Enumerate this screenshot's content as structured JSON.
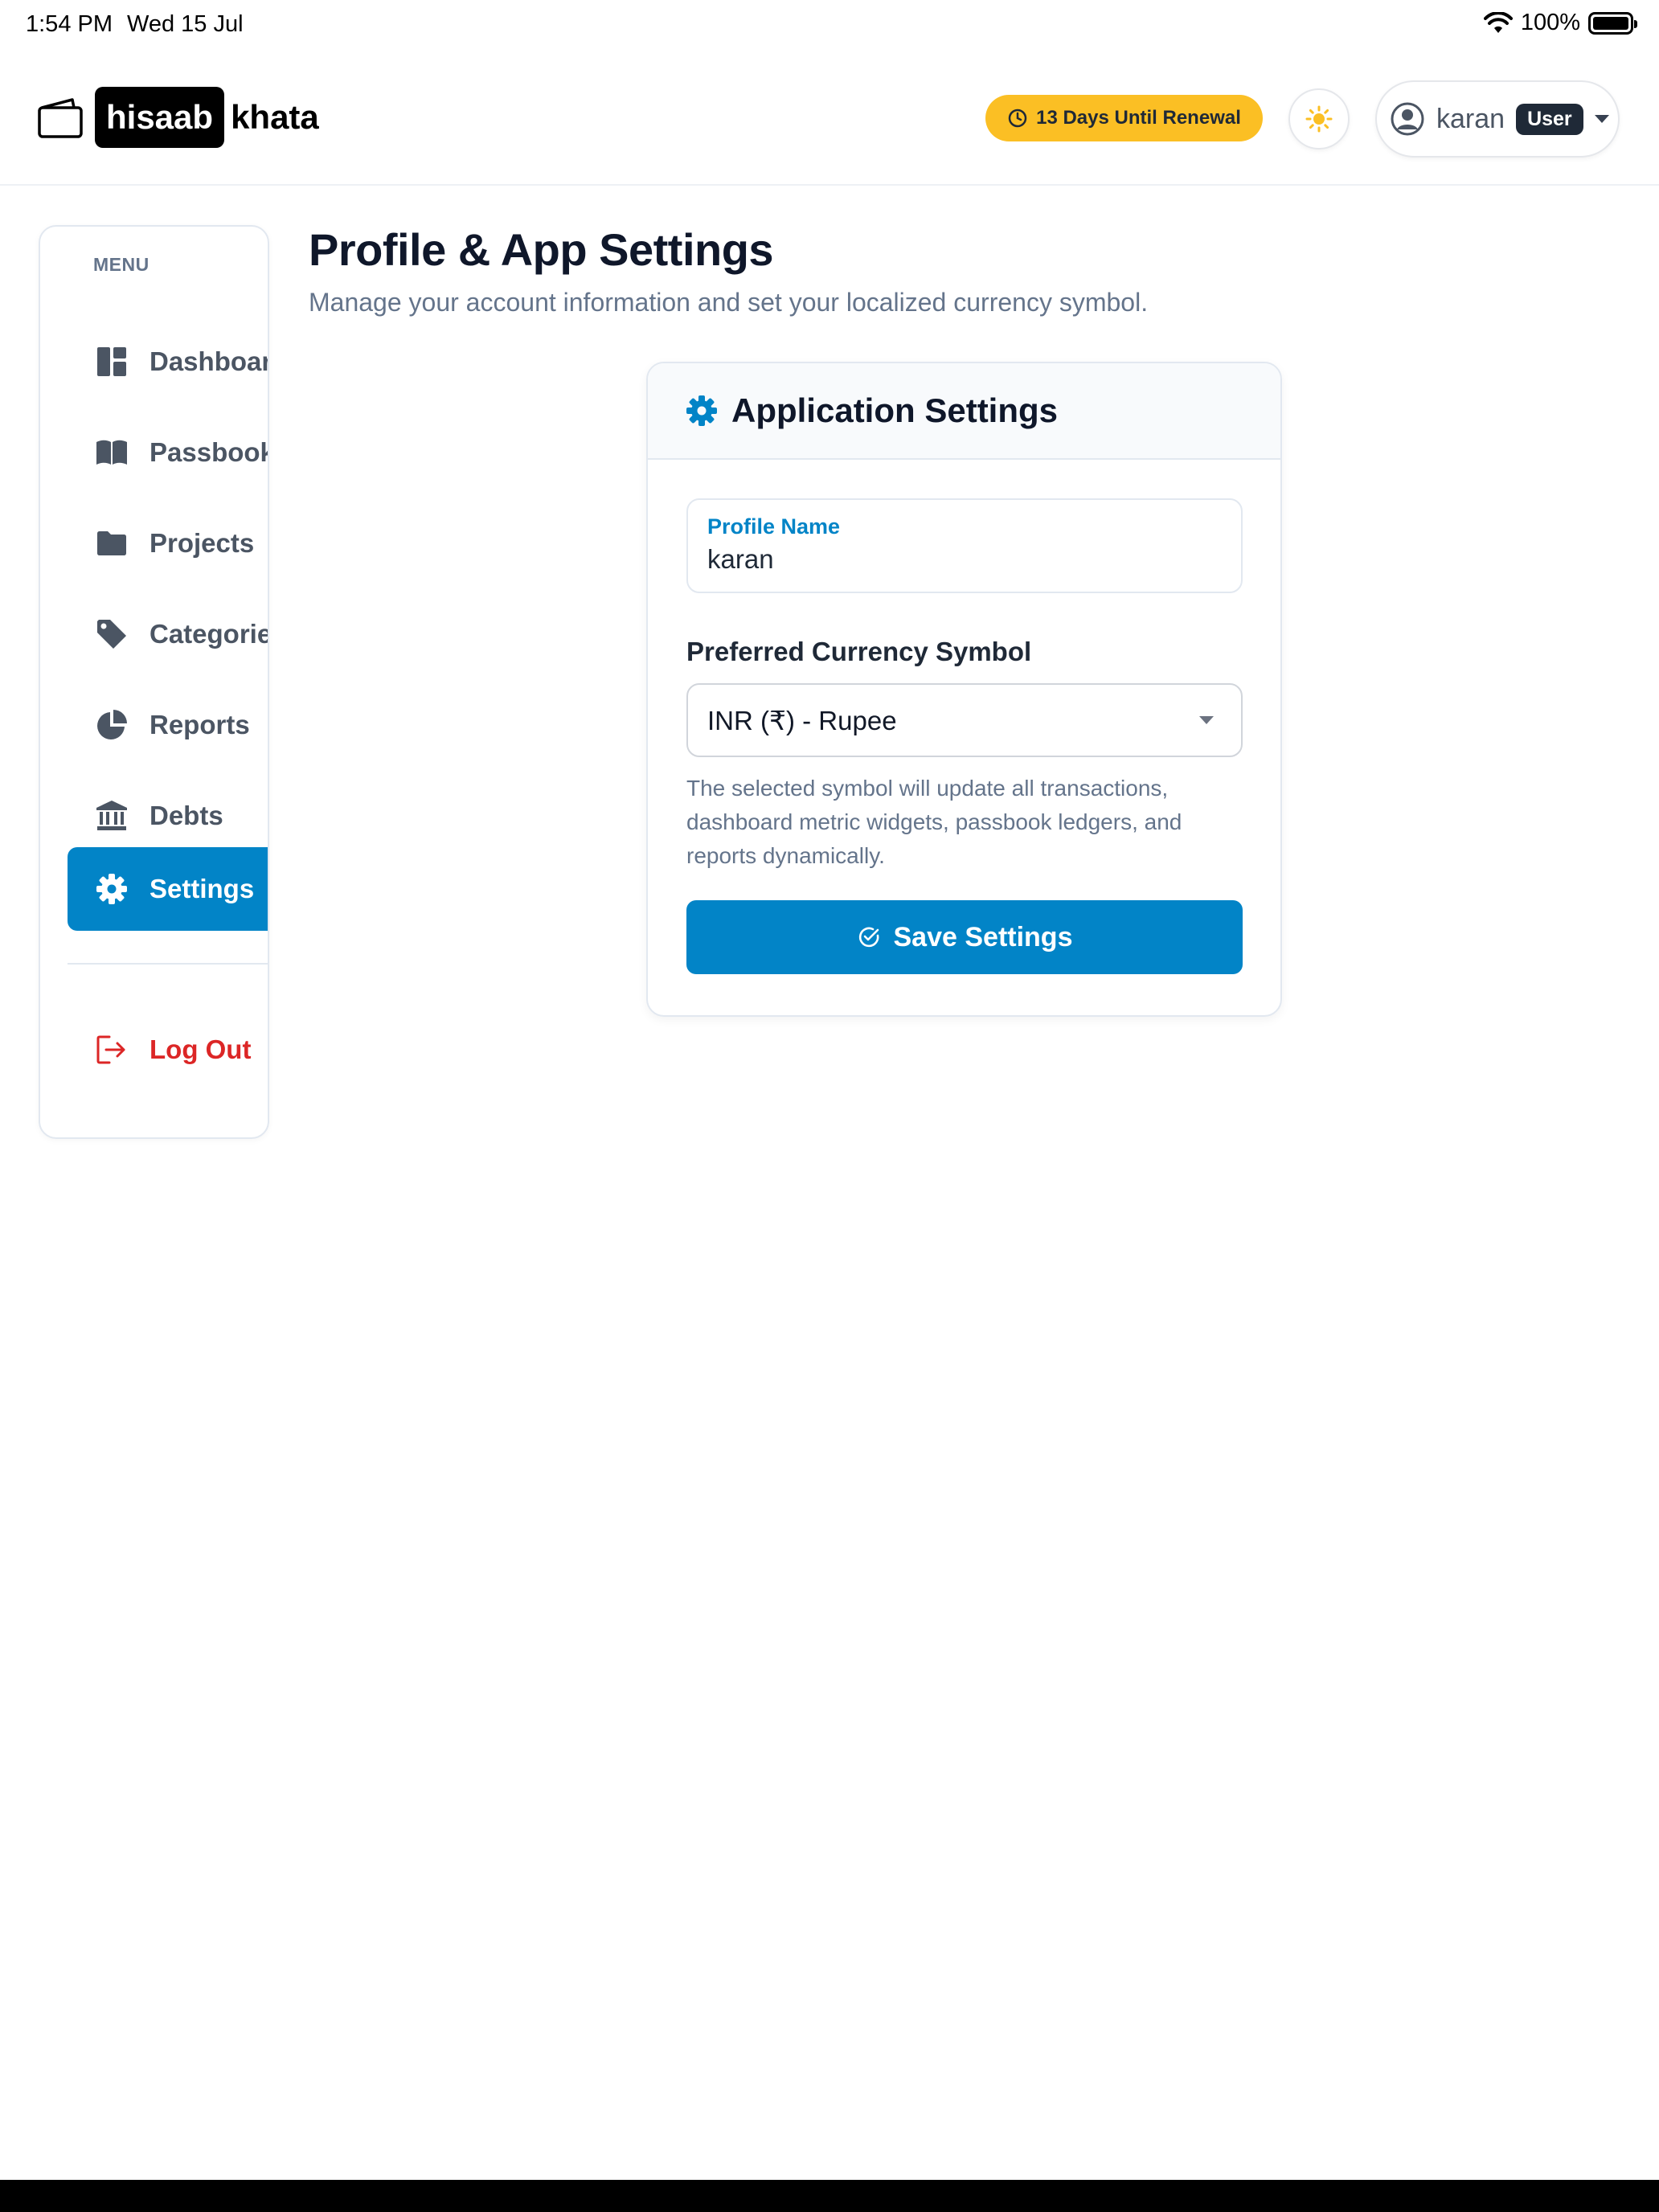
{
  "status_bar": {
    "time": "1:54 PM",
    "date": "Wed 15 Jul",
    "battery": "100%"
  },
  "header": {
    "logo_primary": "hisaab",
    "logo_secondary": "khata",
    "renewal_text": "13 Days Until Renewal",
    "user_name": "karan",
    "user_role": "User"
  },
  "sidebar": {
    "heading": "MENU",
    "items": [
      {
        "label": "Dashboard",
        "icon": "dashboard-icon"
      },
      {
        "label": "Passbook",
        "icon": "book-icon"
      },
      {
        "label": "Projects",
        "icon": "folder-icon"
      },
      {
        "label": "Categories",
        "icon": "tag-icon"
      },
      {
        "label": "Reports",
        "icon": "pie-chart-icon"
      },
      {
        "label": "Debts",
        "icon": "bank-icon"
      },
      {
        "label": "Settings",
        "icon": "gear-icon"
      }
    ],
    "active": "Settings",
    "logout_label": "Log Out"
  },
  "page": {
    "title": "Profile & App Settings",
    "subtitle": "Manage your account information and set your localized currency symbol."
  },
  "settings_card": {
    "title": "Application Settings",
    "profile_name_label": "Profile Name",
    "profile_name_value": "karan",
    "currency_label": "Preferred Currency Symbol",
    "currency_value": "INR (₹) - Rupee",
    "help_text": "The selected symbol will update all transactions, dashboard metric widgets, passbook ledgers, and reports dynamically.",
    "save_label": "Save Settings"
  },
  "colors": {
    "accent": "#0284c7",
    "renewal_badge": "#fbbf24",
    "logout": "#dc2626"
  }
}
